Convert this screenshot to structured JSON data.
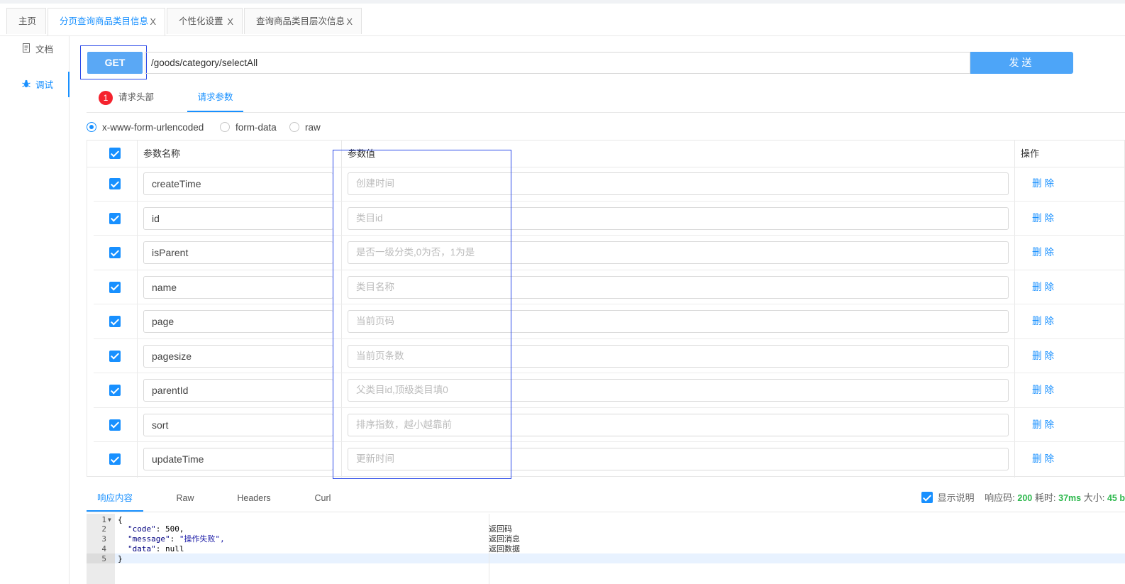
{
  "tabs": [
    {
      "label": "主页",
      "closable": false,
      "active": false
    },
    {
      "label": "分页查询商品类目信息",
      "closable": true,
      "active": true
    },
    {
      "label": "个性化设置",
      "closable": true,
      "active": false
    },
    {
      "label": "查询商品类目层次信息",
      "closable": true,
      "active": false
    }
  ],
  "close_glyph": "X",
  "sidebar": {
    "items": [
      {
        "label": "文档",
        "icon": "document-icon",
        "active": false
      },
      {
        "label": "调试",
        "icon": "bug-icon",
        "active": true
      }
    ]
  },
  "request": {
    "method": "GET",
    "url": "/goods/category/selectAll",
    "send_label": "发送"
  },
  "subtabs": {
    "headers": {
      "label": "请求头部",
      "badge": "1"
    },
    "params": {
      "label": "请求参数"
    }
  },
  "body_types": [
    {
      "label": "x-www-form-urlencoded",
      "checked": true
    },
    {
      "label": "form-data",
      "checked": false
    },
    {
      "label": "raw",
      "checked": false
    }
  ],
  "params_table": {
    "header_name": "参数名称",
    "header_value": "参数值",
    "header_action": "操作",
    "delete_label": "删除",
    "rows": [
      {
        "name": "createTime",
        "placeholder": "创建时间"
      },
      {
        "name": "id",
        "placeholder": "类目id"
      },
      {
        "name": "isParent",
        "placeholder": "是否一级分类,0为否，1为是"
      },
      {
        "name": "name",
        "placeholder": "类目名称"
      },
      {
        "name": "page",
        "placeholder": "当前页码"
      },
      {
        "name": "pagesize",
        "placeholder": "当前页条数"
      },
      {
        "name": "parentId",
        "placeholder": "父类目id,顶级类目填0"
      },
      {
        "name": "sort",
        "placeholder": "排序指数，越小越靠前"
      },
      {
        "name": "updateTime",
        "placeholder": "更新时间"
      }
    ]
  },
  "response": {
    "tabs": [
      "响应内容",
      "Raw",
      "Headers",
      "Curl"
    ],
    "show_desc_label": "显示说明",
    "status_label": "响应码:",
    "status": "200",
    "time_label": "耗时:",
    "time": "37ms",
    "size_label": "大小:",
    "size": "45 b",
    "code_lines": [
      {
        "n": "1",
        "text": "{"
      },
      {
        "n": "2",
        "key": "\"code\"",
        "sep": ": ",
        "val": "500,"
      },
      {
        "n": "3",
        "key": "\"message\"",
        "sep": ": ",
        "val": "\"操作失败\","
      },
      {
        "n": "4",
        "key": "\"data\"",
        "sep": ": ",
        "val": "null"
      },
      {
        "n": "5",
        "text": "}"
      }
    ],
    "descriptions": [
      "返回码",
      "返回消息",
      "返回数据"
    ]
  },
  "colors": {
    "accent": "#1890ff",
    "highlight_frame": "#2a49e8",
    "success": "#2db84d",
    "badge": "#f5222d"
  }
}
